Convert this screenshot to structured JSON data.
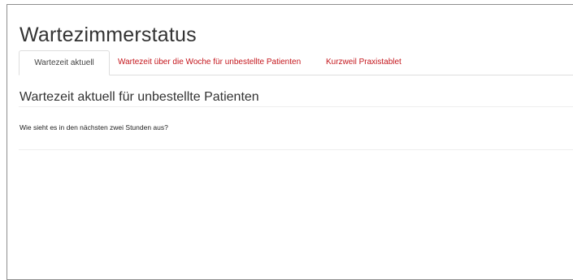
{
  "page": {
    "title": "Wartezimmerstatus"
  },
  "tabs": [
    {
      "label": "Wartezeit aktuell",
      "active": true
    },
    {
      "label": "Wartezeit über die Woche für unbestellte Patienten",
      "active": false
    },
    {
      "label": "Kurzweil Praxistablet",
      "active": false
    }
  ],
  "content": {
    "heading": "Wartezeit aktuell für unbestellte Patienten",
    "question": "Wie sieht es in den nächsten zwei Stunden aus?"
  },
  "colors": {
    "link": "#c4161c",
    "text": "#333333",
    "border": "#dddddd"
  }
}
